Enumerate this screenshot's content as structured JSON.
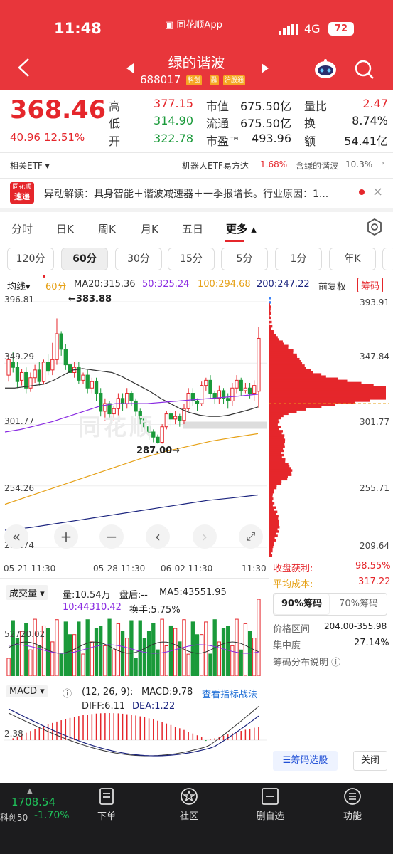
{
  "status_bar": {
    "time": "11:48",
    "app": "同花顺App",
    "network": "4G",
    "battery": "72"
  },
  "header": {
    "stock_name": "绿的谐波",
    "code": "688017",
    "tags": [
      "科创",
      "融",
      "沪股通"
    ]
  },
  "quote": {
    "price": "368.46",
    "change": "40.96",
    "change_pct": "12.51%",
    "fields": [
      {
        "label": "高",
        "value": "377.15",
        "color": "#e5262b"
      },
      {
        "label": "低",
        "value": "314.90",
        "color": "#1a9a3a"
      },
      {
        "label": "开",
        "value": "322.78",
        "color": "#1a9a3a"
      },
      {
        "label": "市值",
        "value": "675.50亿",
        "color": "#222"
      },
      {
        "label": "流通",
        "value": "675.50亿",
        "color": "#222"
      },
      {
        "label": "市盈™",
        "value": "493.96",
        "color": "#222"
      },
      {
        "label": "量比",
        "value": "2.47",
        "color": "#e5262b"
      },
      {
        "label": "换",
        "value": "8.74%",
        "color": "#222"
      },
      {
        "label": "额",
        "value": "54.41亿",
        "color": "#222"
      }
    ]
  },
  "etf": {
    "label": "相关ETF",
    "name": "机器人ETF易方达",
    "pct": "1.68%",
    "contains": "含绿的谐波",
    "weight": "10.3%"
  },
  "news": {
    "badge_top": "同花顺",
    "badge_bottom": "速递",
    "text": "异动解读：具身智能＋谐波减速器＋一季报增长。行业原因：1..."
  },
  "period_tabs": [
    "分时",
    "日K",
    "周K",
    "月K",
    "五日",
    "更多"
  ],
  "minute_tabs": [
    "120分",
    "60分",
    "30分",
    "15分",
    "5分",
    "1分",
    "年K"
  ],
  "ma_bar": {
    "type": "均线",
    "period": "60分",
    "ma20": "MA20:315.36",
    "ma50": "50:325.24",
    "ma100": "100:294.68",
    "ma200": "200:247.22",
    "adjust": "前复权",
    "chips": "筹码"
  },
  "price_axis": [
    "396.81",
    "349.29",
    "301.77",
    "254.26",
    "206.74"
  ],
  "annotations": {
    "high": "←383.88",
    "low": "287.00→"
  },
  "chip_axis": [
    "393.91",
    "347.84",
    "301.77",
    "255.71",
    "209.64"
  ],
  "date_axis": [
    "05-21 11:30",
    "05-28 11:30",
    "06-02 11:30",
    "11:30"
  ],
  "chip_stats": {
    "profit_label": "收盘获利:",
    "profit": "98.55%",
    "cost_label": "平均成本:",
    "cost": "317.22",
    "tab90": "90%筹码",
    "tab70": "70%筹码",
    "range_label": "价格区间",
    "range": "204.00-355.98",
    "conc_label": "集中度",
    "conc": "27.14%",
    "help": "筹码分布说明",
    "select_btn": "筹码选股",
    "close_btn": "关闭"
  },
  "volume_bar": {
    "title": "成交量",
    "vol": "量:10.54万",
    "after": "盘后:--",
    "ma5": "MA5:43551.95",
    "ma10": "10:44310.42",
    "turnover": "换手:5.75%",
    "axis_label": "52720.02"
  },
  "macd_bar": {
    "title": "MACD",
    "params": "(12, 26, 9):",
    "macd": "MACD:9.78",
    "link": "查看指标战法",
    "diff": "DIFF:6.11",
    "dea": "DEA:1.22",
    "axis_label": "2.38"
  },
  "bottom_nav": {
    "index_value": "1708.54",
    "index_name": "科创50",
    "index_pct": "-1.70%",
    "items": [
      "下单",
      "社区",
      "删自选",
      "功能"
    ]
  },
  "chart_data": {
    "type": "candlestick",
    "title": "绿的谐波 60分",
    "y_range": [
      206.74,
      396.81
    ],
    "candles": [
      [
        340,
        352,
        335,
        355
      ],
      [
        350,
        346,
        342,
        358
      ],
      [
        346,
        335,
        330,
        350
      ],
      [
        336,
        342,
        332,
        345
      ],
      [
        342,
        330,
        326,
        346
      ],
      [
        330,
        338,
        327,
        342
      ],
      [
        338,
        344,
        334,
        348
      ],
      [
        344,
        335,
        332,
        350
      ],
      [
        335,
        350,
        333,
        352
      ],
      [
        350,
        343,
        340,
        356
      ],
      [
        344,
        352,
        340,
        365
      ],
      [
        352,
        372,
        348,
        383.88
      ],
      [
        372,
        360,
        355,
        374
      ],
      [
        360,
        348,
        344,
        364
      ],
      [
        348,
        342,
        338,
        352
      ],
      [
        342,
        346,
        338,
        350
      ],
      [
        346,
        336,
        333,
        350
      ],
      [
        336,
        340,
        333,
        342
      ],
      [
        340,
        330,
        326,
        344
      ],
      [
        330,
        335,
        326,
        338
      ],
      [
        335,
        326,
        320,
        338
      ],
      [
        326,
        312,
        308,
        330
      ],
      [
        312,
        318,
        305,
        322
      ],
      [
        318,
        310,
        306,
        320
      ],
      [
        310,
        314,
        305,
        316
      ],
      [
        314,
        322,
        308,
        326
      ],
      [
        322,
        318,
        312,
        326
      ],
      [
        318,
        326,
        314,
        330
      ],
      [
        326,
        320,
        316,
        328
      ],
      [
        320,
        312,
        308,
        322
      ],
      [
        312,
        306,
        302,
        314
      ],
      [
        306,
        300,
        296,
        308
      ],
      [
        300,
        296,
        290,
        302
      ],
      [
        296,
        292,
        288,
        298
      ],
      [
        292,
        288,
        287,
        294
      ],
      [
        288,
        300,
        287,
        302
      ],
      [
        300,
        310,
        298,
        312
      ],
      [
        310,
        306,
        300,
        312
      ],
      [
        306,
        308,
        302,
        312
      ],
      [
        308,
        305,
        300,
        310
      ],
      [
        305,
        314,
        302,
        318
      ],
      [
        314,
        326,
        312,
        330
      ],
      [
        326,
        320,
        316,
        330
      ],
      [
        320,
        318,
        312,
        322
      ],
      [
        318,
        332,
        316,
        335
      ],
      [
        332,
        336,
        328,
        338
      ],
      [
        336,
        326,
        322,
        340
      ],
      [
        326,
        322,
        318,
        328
      ],
      [
        322,
        328,
        318,
        332
      ],
      [
        328,
        322,
        318,
        330
      ],
      [
        322,
        320,
        314,
        326
      ],
      [
        320,
        330,
        316,
        334
      ],
      [
        330,
        336,
        326,
        340
      ],
      [
        336,
        328,
        324,
        338
      ],
      [
        328,
        330,
        326,
        334
      ],
      [
        330,
        326,
        322,
        334
      ],
      [
        326,
        332,
        320,
        336
      ],
      [
        327.5,
        368.46,
        314.9,
        377.15
      ]
    ],
    "volume_colors_note": "red for up, green for down",
    "series_ma": [
      {
        "name": "MA20",
        "values": [
          330,
          330,
          331,
          332,
          333,
          336,
          340,
          344,
          345,
          344,
          343,
          342,
          339,
          335,
          331,
          327,
          322,
          318,
          314,
          311,
          309,
          308,
          308,
          309,
          311,
          313,
          315.36
        ]
      },
      {
        "name": "MA50",
        "values": [
          296,
          298,
          301,
          304,
          308,
          312,
          316,
          318,
          318,
          318,
          319,
          320,
          321,
          322,
          323,
          324,
          325.24
        ]
      },
      {
        "name": "MA100",
        "values": [
          240,
          246,
          252,
          258,
          264,
          270,
          276,
          281,
          285,
          289,
          292,
          294.68
        ]
      },
      {
        "name": "MA200",
        "values": [
          220,
          222,
          225,
          228,
          231,
          234,
          237,
          240,
          243,
          245,
          247.22
        ]
      }
    ]
  }
}
